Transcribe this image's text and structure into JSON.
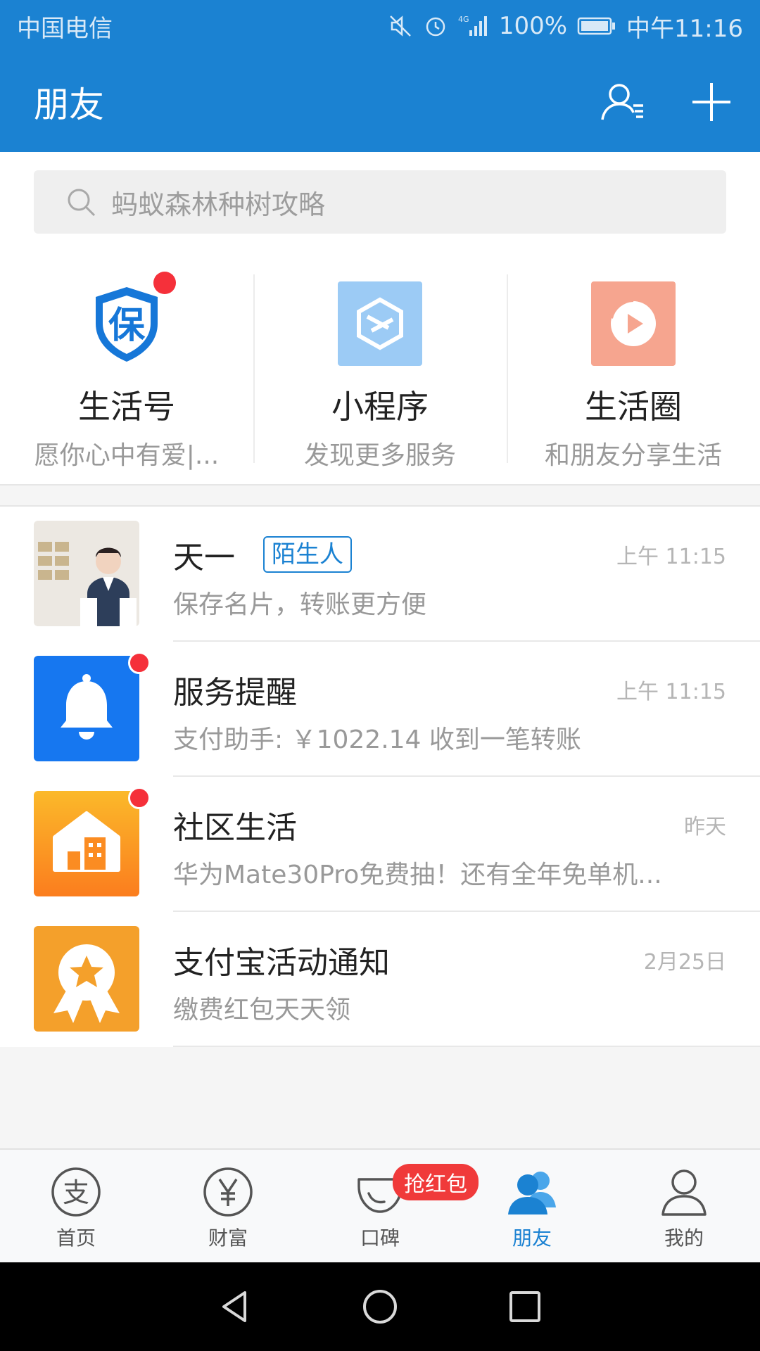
{
  "status_bar": {
    "carrier": "中国电信",
    "network": "4G",
    "battery": "100%",
    "time": "中午11:16"
  },
  "header": {
    "title": "朋友",
    "icons": [
      "contacts-icon",
      "add-icon"
    ]
  },
  "search": {
    "placeholder": "蚂蚁森林种树攻略"
  },
  "entries": [
    {
      "title": "生活号",
      "subtitle": "愿你心中有爱|...",
      "icon": "shield-bao-icon",
      "has_dot": true
    },
    {
      "title": "小程序",
      "subtitle": "发现更多服务",
      "icon": "mini-program-icon",
      "has_dot": false
    },
    {
      "title": "生活圈",
      "subtitle": "和朋友分享生活",
      "icon": "life-circle-icon",
      "has_dot": false
    }
  ],
  "messages": [
    {
      "name": "天一",
      "tag": "陌生人",
      "time": "上午 11:15",
      "preview": "保存名片，转账更方便",
      "avatar": "person-avatar",
      "has_dot": false
    },
    {
      "name": "服务提醒",
      "time": "上午 11:15",
      "preview": "支付助手: ￥1022.14 收到一笔转账",
      "avatar": "bell-icon",
      "has_dot": true
    },
    {
      "name": "社区生活",
      "time": "昨天",
      "preview": "华为Mate30Pro免费抽！还有全年免单机...",
      "avatar": "community-house-icon",
      "has_dot": true
    },
    {
      "name": "支付宝活动通知",
      "time": "2月25日",
      "preview": "缴费红包天天领",
      "avatar": "medal-star-icon",
      "has_dot": false
    }
  ],
  "tabbar": {
    "tabs": [
      {
        "label": "首页",
        "icon": "alipay-home-icon",
        "active": false
      },
      {
        "label": "财富",
        "icon": "yen-icon",
        "active": false
      },
      {
        "label": "口碑",
        "icon": "koubei-icon",
        "active": false,
        "badge": "抢红包"
      },
      {
        "label": "朋友",
        "icon": "friends-icon",
        "active": true
      },
      {
        "label": "我的",
        "icon": "person-icon",
        "active": false
      }
    ]
  },
  "colors": {
    "primary": "#1b82d2",
    "badge_red": "#f5303a"
  }
}
